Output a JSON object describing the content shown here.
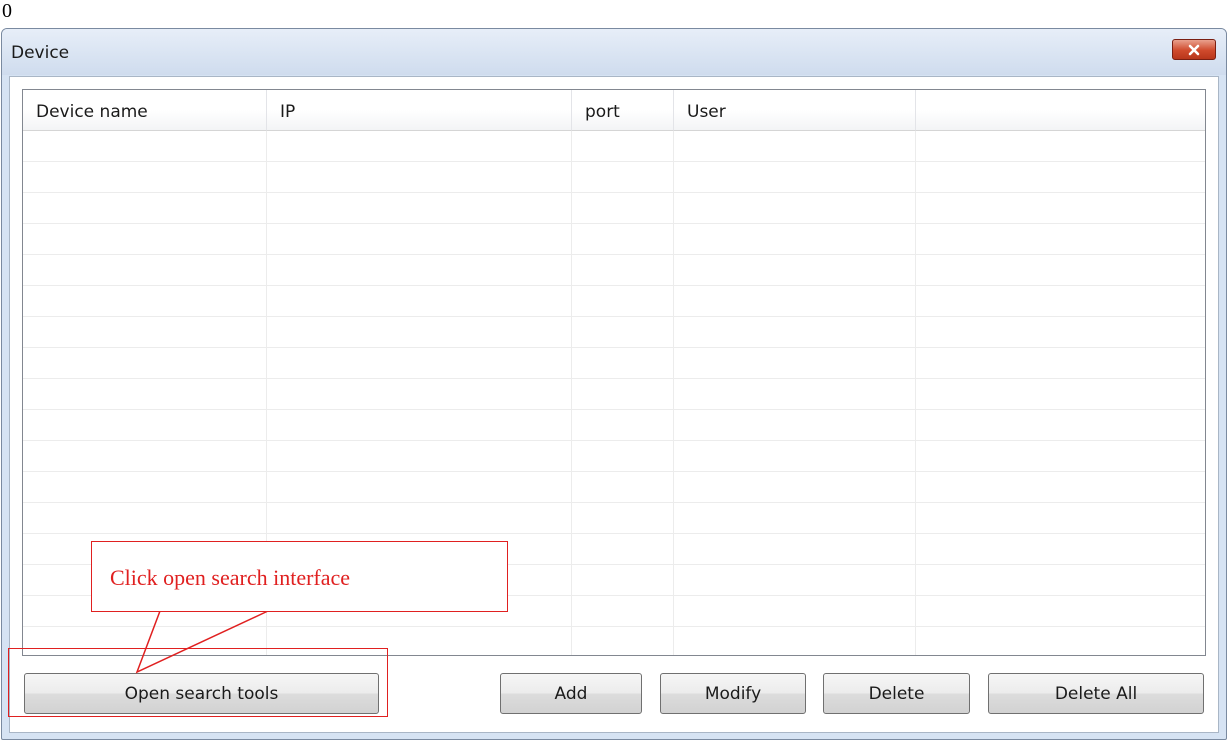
{
  "page_number": "0",
  "window": {
    "title": "Device",
    "close_icon": "close-x-icon"
  },
  "device_list": {
    "columns": [
      "Device name",
      "IP",
      "port",
      "User",
      ""
    ],
    "rows": []
  },
  "buttons": {
    "open_search": "Open search tools",
    "add": "Add",
    "modify": "Modify",
    "delete": "Delete",
    "delete_all": "Delete All"
  },
  "annotation": {
    "text": "Click open search interface",
    "color": "#e02020"
  },
  "colors": {
    "close_button": "#cf4a2c",
    "titlebar": "#d6e3f3"
  }
}
